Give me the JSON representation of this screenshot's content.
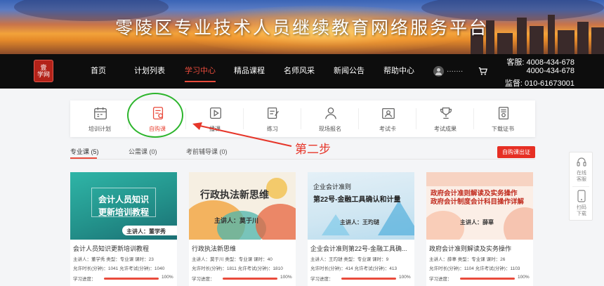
{
  "banner": {
    "title": "零陵区专业技术人员继续教育网络服务平台"
  },
  "nav": {
    "logo_text": "壹学网",
    "items": [
      {
        "label": "首页"
      },
      {
        "label": "计划列表"
      },
      {
        "label": "学习中心",
        "active": true
      },
      {
        "label": "精品课程"
      },
      {
        "label": "名师风采"
      },
      {
        "label": "新闻公告"
      },
      {
        "label": "帮助中心"
      }
    ],
    "username": "·······",
    "contact": {
      "line1": "客服: 4008-434-678",
      "line2": "4000-434-678",
      "line3": "监督: 010-61673001"
    }
  },
  "iconbar": [
    {
      "label": "培训计划",
      "icon": "calendar-icon"
    },
    {
      "label": "自购课",
      "icon": "self-purchase-icon",
      "active": true
    },
    {
      "label": "播课",
      "icon": "video-icon"
    },
    {
      "label": "练习",
      "icon": "exercise-icon"
    },
    {
      "label": "现场报名",
      "icon": "person-icon"
    },
    {
      "label": "考试卡",
      "icon": "id-card-icon"
    },
    {
      "label": "考试成果",
      "icon": "trophy-icon"
    },
    {
      "label": "下载证书",
      "icon": "certificate-icon"
    }
  ],
  "annotation": {
    "text": "第二步"
  },
  "tabs": [
    {
      "label": "专业课 (5)",
      "active": true
    },
    {
      "label": "公需课 (0)"
    },
    {
      "label": "考前辅导课 (0)"
    }
  ],
  "cert_button": "自购课出证",
  "side": {
    "service": "在线\n客服",
    "download": "扫码\n下载"
  },
  "cards": [
    {
      "thumb_title_1": "会计人员知识",
      "thumb_title_2": "更新培训教程",
      "thumb_lecturer": "主讲人：董学秀",
      "title": "会计人员知识更新培训教程",
      "meta1": "主讲人：董学秀    类型：专业课    课时：23",
      "meta2": "允许时长(分钟)：1041  允许考试(分钟)：1040",
      "progress_label": "学习进度：",
      "progress": "100%"
    },
    {
      "thumb_title_1": "行政执法新思维",
      "thumb_lecturer": "主讲人：莫于川",
      "title": "行政执法新思维",
      "meta1": "主讲人：莫于川    类型：专业课    课时：40",
      "meta2": "允许时长(分钟)：1811  允许考试(分钟)：1810",
      "progress_label": "学习进度：",
      "progress": "100%"
    },
    {
      "thumb_title_0": "企业会计准则",
      "thumb_title_1": "第22号-金融工具确认和计量",
      "thumb_lecturer": "主讲人：王玓琎",
      "title": "企业会计准则第22号-金融工具确...",
      "meta1": "主讲人：王玓琎    类型：专业课    课时：9",
      "meta2": "允许时长(分钟)：414  允许考试(分钟)：413",
      "progress_label": "学习进度：",
      "progress": "100%"
    },
    {
      "thumb_title_1": "政府会计准则解读及实务操作",
      "thumb_title_2": "政府会计制度会计科目操作详解",
      "thumb_lecturer": "主讲人：薛辜",
      "title": "政府会计准则解读及实务操作",
      "meta1": "主讲人：薛辜    类型：专业课    课时：26",
      "meta2": "允许时长(分钟)：1104  允许考试(分钟)：1103",
      "progress_label": "学习进度：",
      "progress": "100%"
    }
  ],
  "colors": {
    "accent": "#e94b3c",
    "nav_bg": "#0d0d0d",
    "annotation_circle": "#2db52d"
  }
}
